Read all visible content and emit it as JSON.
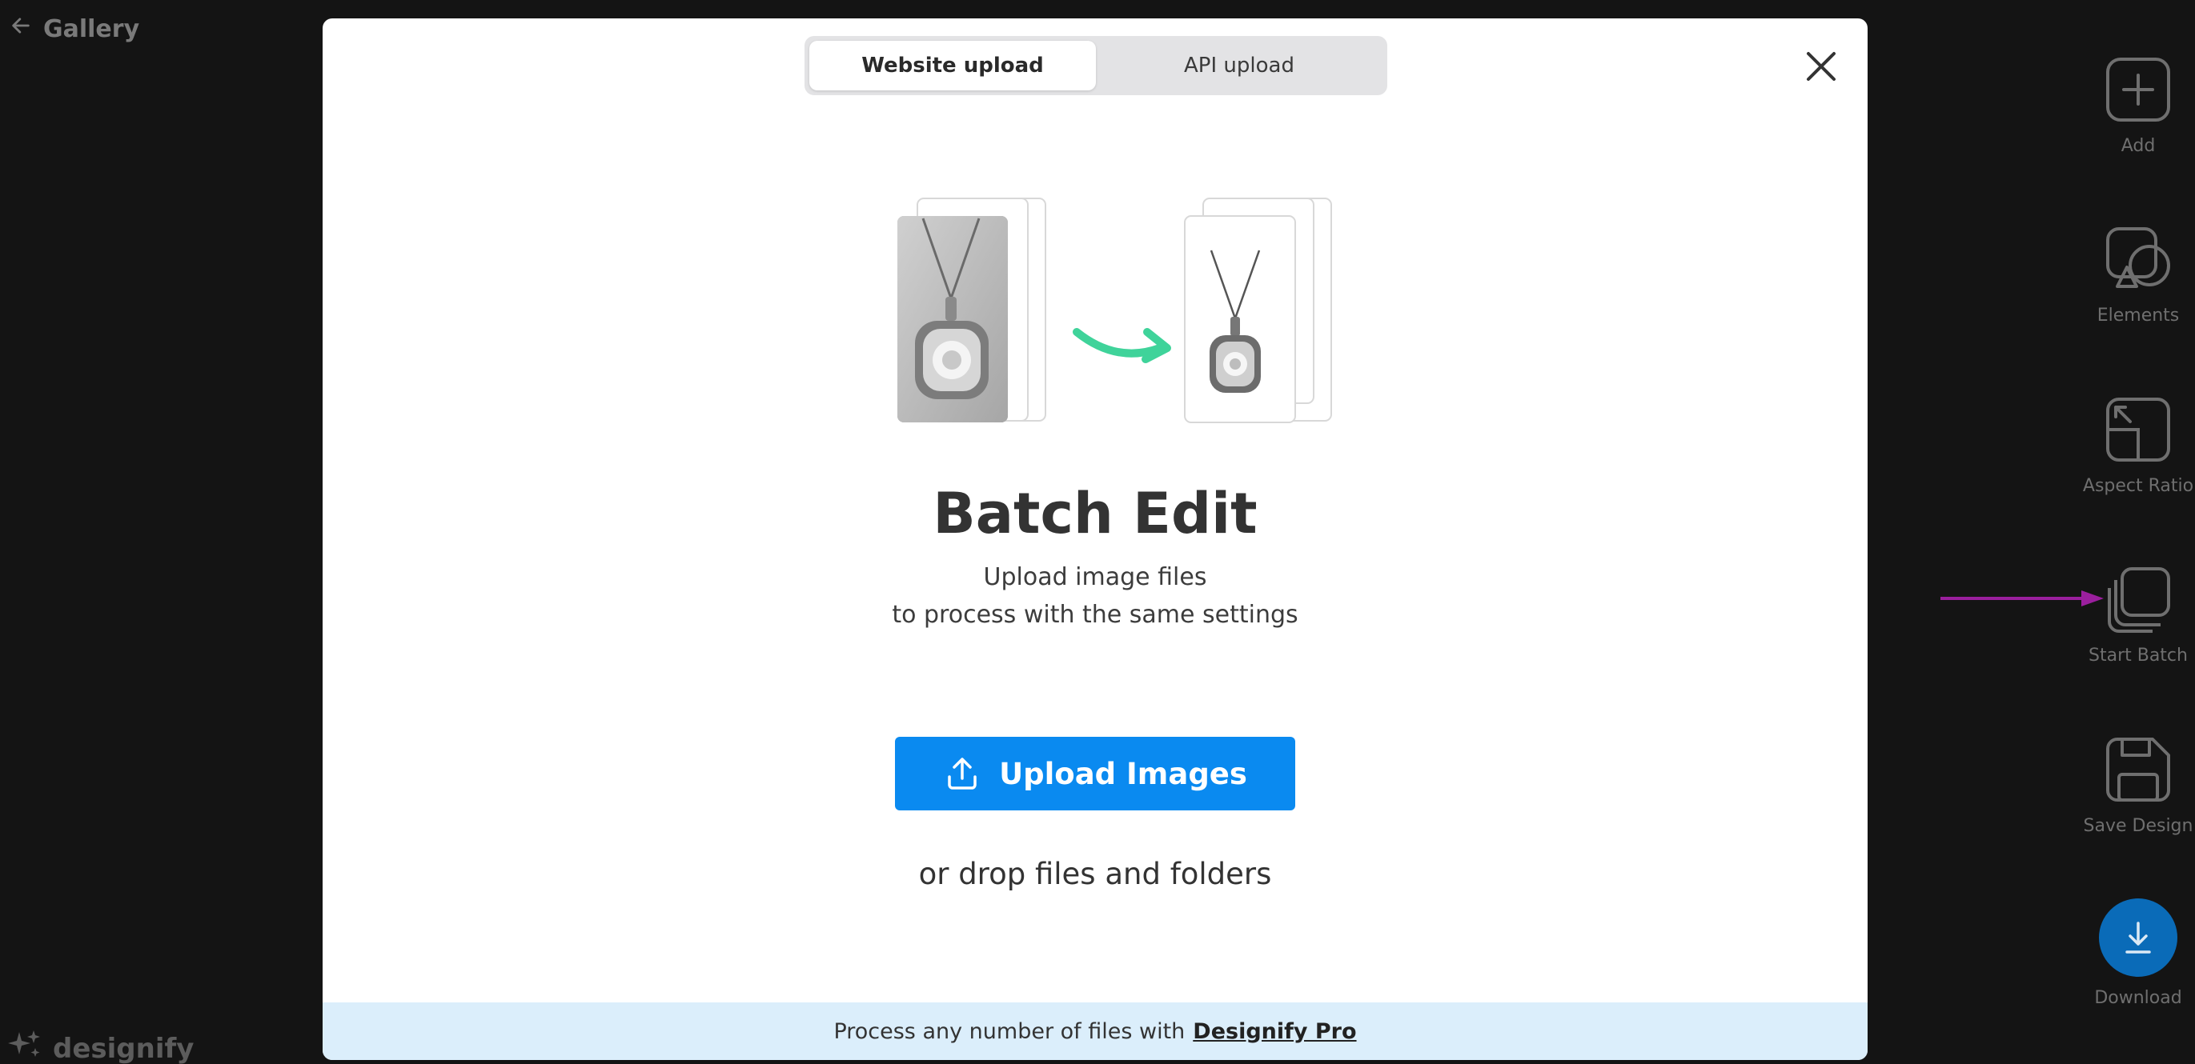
{
  "app": {
    "back_label": "Gallery",
    "brand_name": "designify"
  },
  "rail": {
    "items": [
      {
        "label": "Add",
        "icon": "plus-square-icon"
      },
      {
        "label": "Elements",
        "icon": "shapes-icon"
      },
      {
        "label": "Aspect Ratio",
        "icon": "aspect-ratio-icon"
      },
      {
        "label": "Start Batch",
        "icon": "stack-icon"
      },
      {
        "label": "Save Design",
        "icon": "save-icon"
      },
      {
        "label": "Download",
        "icon": "download-icon"
      }
    ]
  },
  "modal": {
    "tabs": [
      "Website upload",
      "API upload"
    ],
    "active_tab": "Website upload",
    "title": "Batch Edit",
    "subtitle_line1": "Upload image files",
    "subtitle_line2": "to process with the same settings",
    "upload_button": "Upload Images",
    "drop_hint": "or drop files and folders",
    "footer_text": "Process any number of files with",
    "footer_link": "Designify Pro"
  },
  "colors": {
    "accent": "#0a8af0",
    "download_bg": "#0a6bb8",
    "pointer_arrow": "#9b1f9e",
    "footer_bg": "#dbeefb",
    "illustration_arrow": "#3fd39a"
  }
}
